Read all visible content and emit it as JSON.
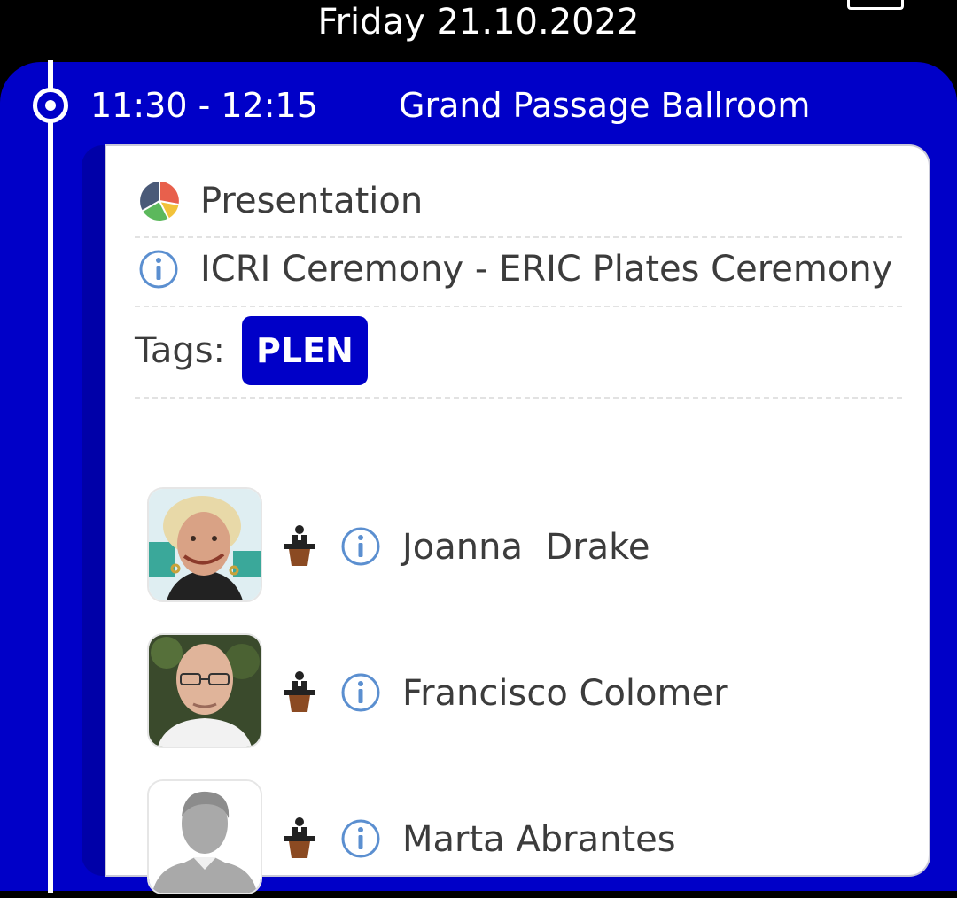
{
  "header": {
    "date": "Friday 21.10.2022",
    "keyboard_icon": "keyboard-icon"
  },
  "session": {
    "time": "11:30 - 12:15",
    "room": "Grand Passage Ballroom",
    "type_icon": "pie-chart-icon",
    "type": "Presentation",
    "title": "ICRI Ceremony - ERIC Plates Ceremony",
    "tags_label": "Tags:",
    "tags": [
      "PLEN"
    ]
  },
  "speakers": [
    {
      "name": "Joanna  Drake",
      "role_icon": "podium-speaker-icon",
      "avatar": "photo"
    },
    {
      "name": "Francisco Colomer",
      "role_icon": "podium-speaker-icon",
      "avatar": "photo"
    },
    {
      "name": "Marta Abrantes",
      "role_icon": "podium-speaker-icon",
      "avatar": "placeholder-silhouette"
    }
  ],
  "colors": {
    "panel_blue": "#0000c8",
    "text": "#3c3c3c",
    "info_blue": "#5b8fd0"
  }
}
